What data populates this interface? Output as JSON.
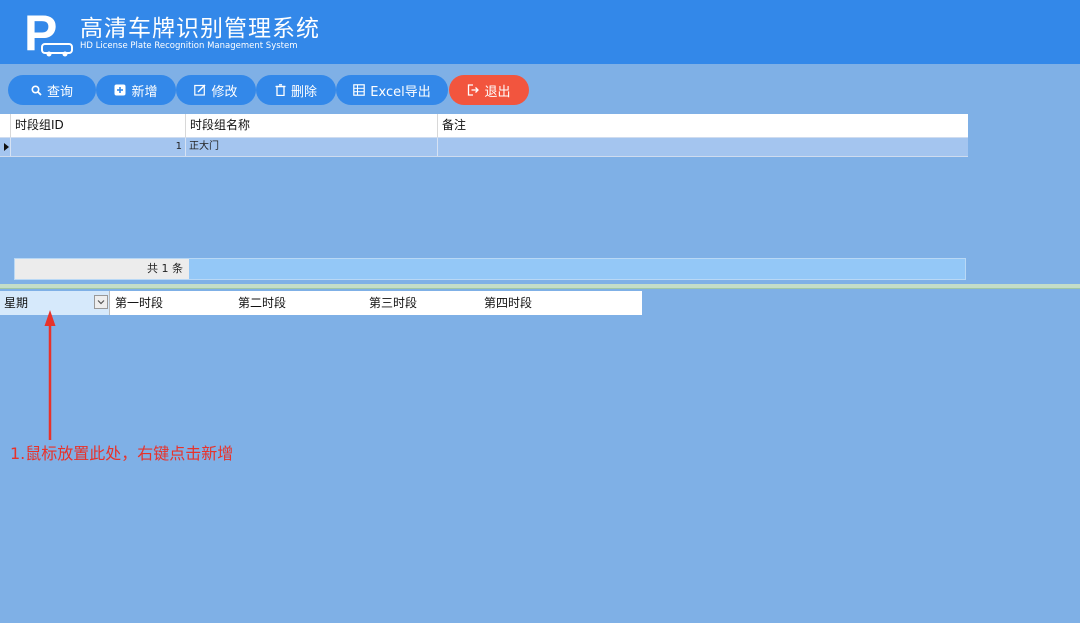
{
  "app": {
    "title": "高清车牌识别管理系统",
    "subtitle": "HD License Plate Recognition Management System",
    "logo_letter": "P"
  },
  "toolbar": {
    "query": "查询",
    "add": "新增",
    "edit": "修改",
    "delete": "删除",
    "export": "Excel导出",
    "exit": "退出"
  },
  "group_table": {
    "columns": [
      "时段组ID",
      "时段组名称",
      "备注"
    ],
    "rows": [
      {
        "id": "1",
        "name": "正大门",
        "note": ""
      }
    ],
    "footer_count": "共 1 条"
  },
  "period_table": {
    "columns": [
      "星期",
      "第一时段",
      "第二时段",
      "第三时段",
      "第四时段"
    ]
  },
  "annotation": {
    "text": "1.鼠标放置此处，右键点击新增"
  },
  "colors": {
    "header_bg": "#3388e9",
    "button_bg": "#3388e9",
    "exit_button_bg": "#f2553e",
    "page_bg": "#7fb0e6",
    "selected_row_bg": "#a4c5ef",
    "annotation": "#e8322a"
  }
}
